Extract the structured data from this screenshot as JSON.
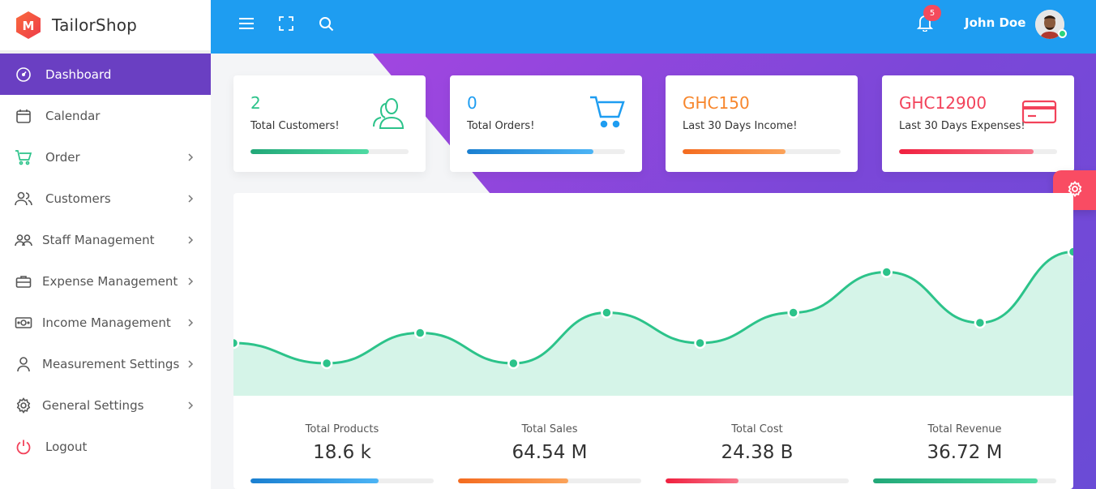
{
  "brand": {
    "name": "TailorShop",
    "logo_letter": "M"
  },
  "sidebar": {
    "items": [
      {
        "label": "Dashboard",
        "icon": "dashboard-icon",
        "active": true,
        "has_submenu": false
      },
      {
        "label": "Calendar",
        "icon": "calendar-icon",
        "active": false,
        "has_submenu": false
      },
      {
        "label": "Order",
        "icon": "cart-icon",
        "active": false,
        "has_submenu": true
      },
      {
        "label": "Customers",
        "icon": "users-icon",
        "active": false,
        "has_submenu": true
      },
      {
        "label": "Staff Management",
        "icon": "staff-icon",
        "active": false,
        "has_submenu": true
      },
      {
        "label": "Expense Management",
        "icon": "briefcase-icon",
        "active": false,
        "has_submenu": true
      },
      {
        "label": "Income Management",
        "icon": "money-icon",
        "active": false,
        "has_submenu": true
      },
      {
        "label": "Measurement Settings",
        "icon": "user-icon",
        "active": false,
        "has_submenu": true
      },
      {
        "label": "General Settings",
        "icon": "gear-icon",
        "active": false,
        "has_submenu": true
      },
      {
        "label": "Logout",
        "icon": "power-icon",
        "active": false,
        "has_submenu": false
      }
    ]
  },
  "topbar": {
    "notification_count": "5",
    "user_name": "John Doe"
  },
  "cards": [
    {
      "value": "2",
      "label": "Total Customers!",
      "color": "#2cc38a",
      "progress": 0.75
    },
    {
      "value": "0",
      "label": "Total Orders!",
      "color": "#1e9df1",
      "progress": 0.8
    },
    {
      "value": "GHC150",
      "label": "Last 30 Days Income!",
      "color": "#f7862c",
      "progress": 0.65
    },
    {
      "value": "GHC12900",
      "label": "Last 30 Days Expenses!",
      "color": "#f2425a",
      "progress": 0.85
    }
  ],
  "summary": [
    {
      "label": "Total Products",
      "value": "18.6 k",
      "progress": 0.7
    },
    {
      "label": "Total Sales",
      "value": "64.54 M",
      "progress": 0.6
    },
    {
      "label": "Total Cost",
      "value": "24.38 B",
      "progress": 0.4
    },
    {
      "label": "Total Revenue",
      "value": "36.72 M",
      "progress": 0.9
    }
  ],
  "colors": {
    "sidebar_active": "#6a3fc2",
    "topbar": "#1e9df1",
    "line": "#2cc38a",
    "area": "#d5f4e8"
  },
  "chart_data": {
    "type": "area",
    "x": [
      0,
      1,
      2,
      3,
      4,
      5,
      6,
      7,
      8,
      9
    ],
    "values": [
      26,
      16,
      31,
      16,
      41,
      26,
      41,
      61,
      36,
      71
    ],
    "ylim": [
      0,
      100
    ],
    "grid": false
  }
}
